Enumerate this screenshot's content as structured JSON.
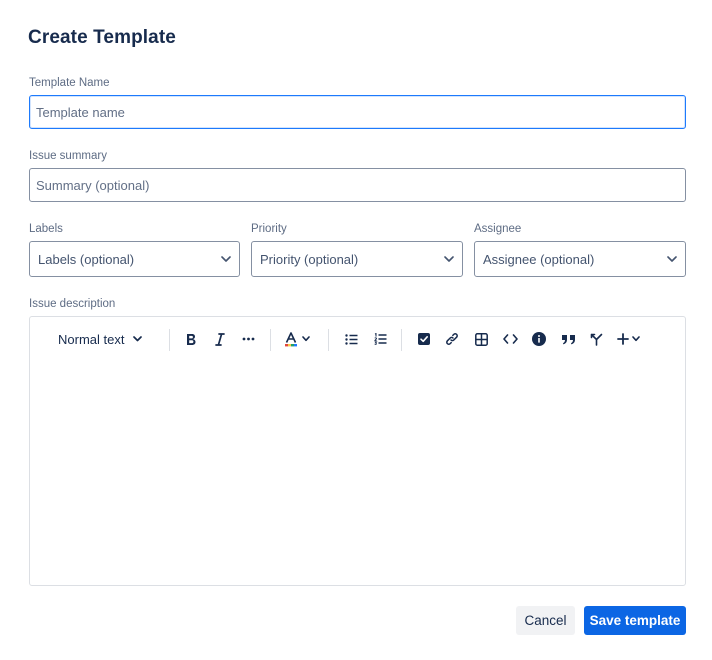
{
  "dialog": {
    "title": "Create Template"
  },
  "template_name": {
    "label": "Template Name",
    "placeholder": "Template name",
    "value": ""
  },
  "issue_summary": {
    "label": "Issue summary",
    "placeholder": "Summary (optional)",
    "value": ""
  },
  "labels": {
    "label": "Labels",
    "placeholder": "Labels (optional)"
  },
  "priority": {
    "label": "Priority",
    "placeholder": "Priority (optional)"
  },
  "assignee": {
    "label": "Assignee",
    "placeholder": "Assignee (optional)"
  },
  "description": {
    "label": "Issue description",
    "toolbar": {
      "text_style": "Normal text",
      "icons": [
        "bold-icon",
        "italic-icon",
        "more-formatting-icon",
        "text-color-icon",
        "bullet-list-icon",
        "numbered-list-icon",
        "task-checkbox-icon",
        "link-icon",
        "table-icon",
        "code-icon",
        "info-panel-icon",
        "quote-icon",
        "decision-icon",
        "insert-plus-icon"
      ]
    },
    "content": ""
  },
  "actions": {
    "cancel_label": "Cancel",
    "save_label": "Save template"
  },
  "colors": {
    "accent": "#0c66e4",
    "focus_border": "#1d7afc",
    "border": "#8590a2",
    "text": "#172b4d"
  }
}
